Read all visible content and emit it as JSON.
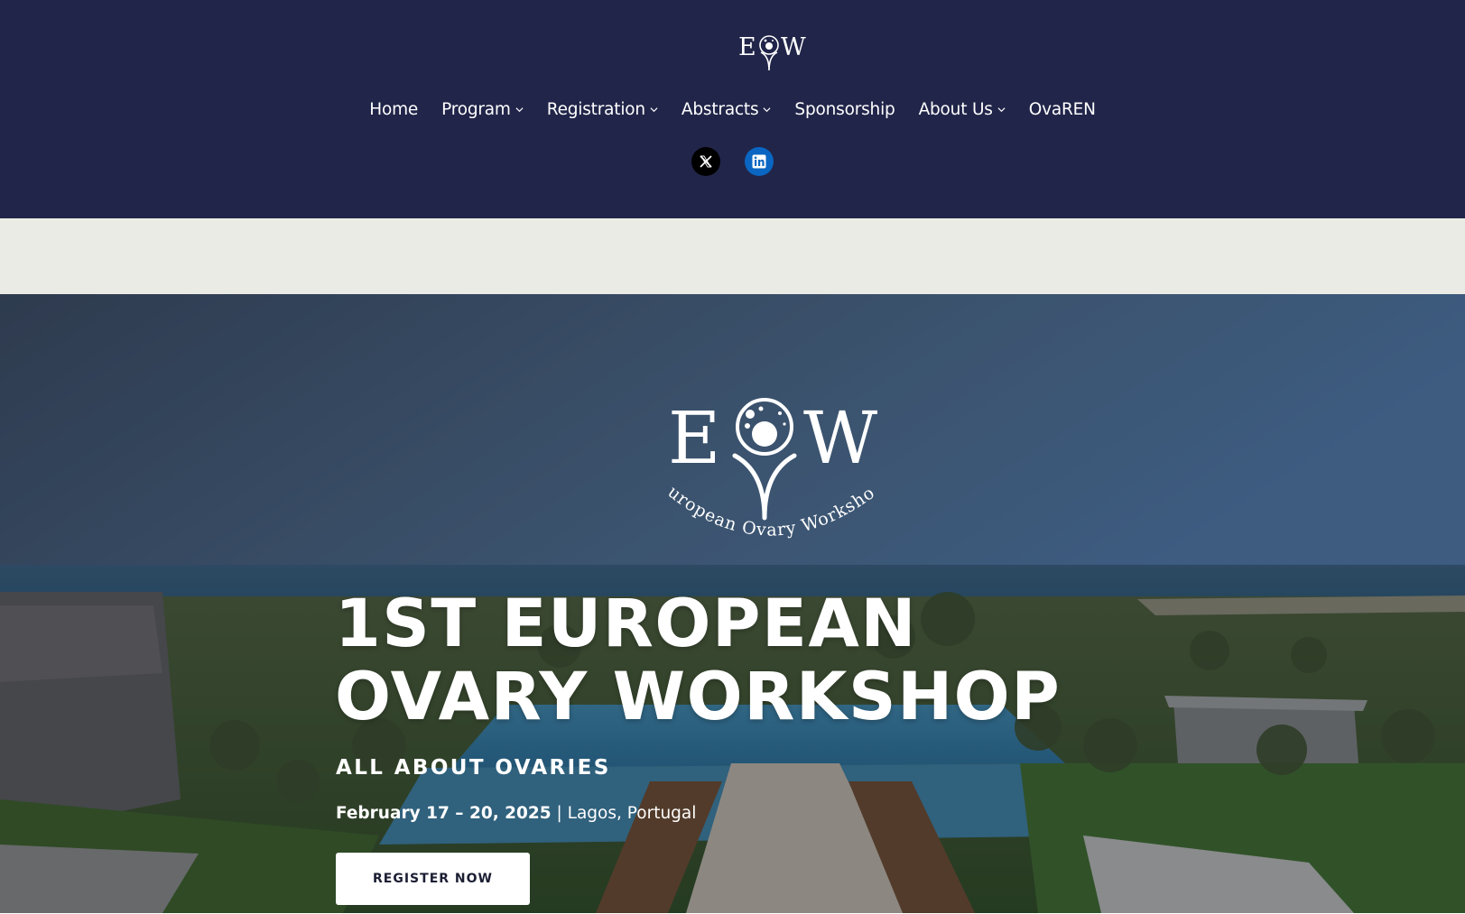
{
  "header": {
    "logo_text": "EOW",
    "nav": [
      {
        "label": "Home",
        "has_dropdown": false
      },
      {
        "label": "Program",
        "has_dropdown": true
      },
      {
        "label": "Registration",
        "has_dropdown": true
      },
      {
        "label": "Abstracts",
        "has_dropdown": true
      },
      {
        "label": "Sponsorship",
        "has_dropdown": false
      },
      {
        "label": "About Us",
        "has_dropdown": true
      },
      {
        "label": "OvaREN",
        "has_dropdown": false
      }
    ],
    "socials": [
      {
        "name": "x-icon",
        "glyph": "𝕏"
      },
      {
        "name": "linkedin-icon",
        "glyph": "in"
      }
    ]
  },
  "hero": {
    "logo_text": "EOW",
    "logo_caption": "European Ovary Workshop",
    "title_line1": "1ST EUROPEAN",
    "title_line2": "OVARY WORKSHOP",
    "subtitle": "ALL ABOUT OVARIES",
    "date_strong": "February 17 – 20, 2025",
    "date_rest": " | Lagos, Portugal",
    "cta_label": "REGISTER NOW"
  },
  "colors": {
    "header_bg": "#212549",
    "band_bg": "#ebebe6",
    "linkedin": "#0a66c2"
  }
}
